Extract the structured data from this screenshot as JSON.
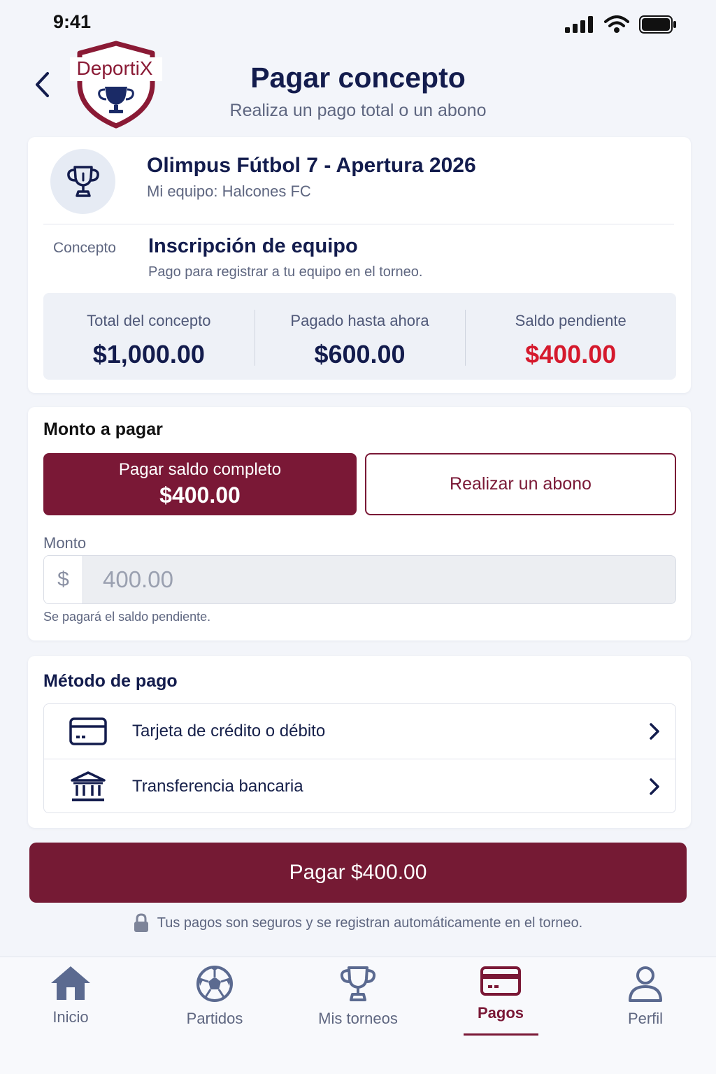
{
  "status_bar": {
    "time": "9:41"
  },
  "header": {
    "logo_text": "DeportiX",
    "title": "Pagar concepto",
    "subtitle": "Realiza un pago total o un abono"
  },
  "tournament": {
    "name": "Olimpus Fútbol 7 - Apertura 2026",
    "team": "Mi equipo: Halcones FC"
  },
  "concept": {
    "label": "Concepto",
    "name": "Inscripción de equipo",
    "description": "Pago para registrar a tu equipo en el torneo."
  },
  "summary": [
    {
      "label": "Total del concepto",
      "value": "$1,000.00"
    },
    {
      "label": "Pagado hasta ahora",
      "value": "$600.00"
    },
    {
      "label": "Saldo pendiente",
      "value": "$400.00"
    }
  ],
  "amount_section": {
    "title": "Monto a pagar",
    "full_option_label": "Pagar saldo completo",
    "full_option_amount": "$400.00",
    "partial_option_label": "Realizar un abono",
    "field_label": "Monto",
    "currency_prefix": "$",
    "field_value": "400.00",
    "hint": "Se pagará el saldo pendiente."
  },
  "payment_methods": {
    "title": "Método de pago",
    "items": [
      {
        "label": "Tarjeta de crédito o débito",
        "icon": "credit-card-icon"
      },
      {
        "label": "Transferencia bancaria",
        "icon": "bank-icon"
      }
    ]
  },
  "pay_button": "Pagar $400.00",
  "secure_note": "Tus pagos son seguros y se registran automáticamente en el torneo.",
  "tabs": [
    {
      "label": "Inicio",
      "icon": "home-icon",
      "active": false
    },
    {
      "label": "Partidos",
      "icon": "soccer-ball-icon",
      "active": false
    },
    {
      "label": "Mis torneos",
      "icon": "trophy-icon",
      "active": false
    },
    {
      "label": "Pagos",
      "icon": "credit-card-icon",
      "active": true
    },
    {
      "label": "Perfil",
      "icon": "user-icon",
      "active": false
    }
  ],
  "colors": {
    "brand": "#7a1836",
    "navy": "#131c4d",
    "pending": "#d51a2d"
  }
}
